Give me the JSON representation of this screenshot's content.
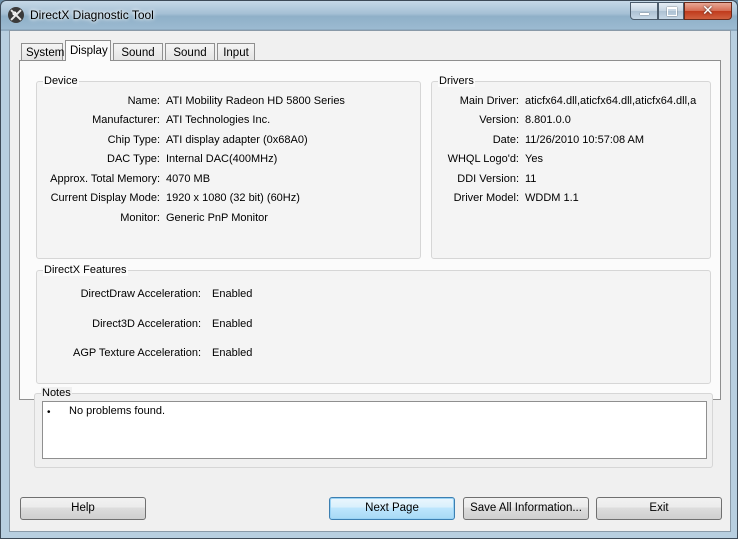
{
  "window": {
    "title": "DirectX Diagnostic Tool",
    "controls": {
      "minimize": "–",
      "maximize": "□",
      "close": "✕"
    }
  },
  "tabs": [
    {
      "label": "System"
    },
    {
      "label": "Display"
    },
    {
      "label": "Sound 1"
    },
    {
      "label": "Sound 2"
    },
    {
      "label": "Input"
    }
  ],
  "active_tab": "Display",
  "device": {
    "title": "Device",
    "rows": [
      {
        "label": "Name:",
        "value": "ATI Mobility Radeon HD 5800 Series"
      },
      {
        "label": "Manufacturer:",
        "value": "ATI Technologies Inc."
      },
      {
        "label": "Chip Type:",
        "value": "ATI display adapter (0x68A0)"
      },
      {
        "label": "DAC Type:",
        "value": "Internal DAC(400MHz)"
      },
      {
        "label": "Approx. Total Memory:",
        "value": "4070 MB"
      },
      {
        "label": "Current Display Mode:",
        "value": "1920 x 1080 (32 bit) (60Hz)"
      },
      {
        "label": "Monitor:",
        "value": "Generic PnP Monitor"
      }
    ]
  },
  "drivers": {
    "title": "Drivers",
    "rows": [
      {
        "label": "Main Driver:",
        "value": "aticfx64.dll,aticfx64.dll,aticfx64.dll,a"
      },
      {
        "label": "Version:",
        "value": "8.801.0.0"
      },
      {
        "label": "Date:",
        "value": "11/26/2010 10:57:08 AM"
      },
      {
        "label": "WHQL Logo'd:",
        "value": "Yes"
      },
      {
        "label": "DDI Version:",
        "value": "11"
      },
      {
        "label": "Driver Model:",
        "value": "WDDM 1.1"
      }
    ]
  },
  "features": {
    "title": "DirectX Features",
    "rows": [
      {
        "label": "DirectDraw Acceleration:",
        "value": "Enabled"
      },
      {
        "label": "Direct3D Acceleration:",
        "value": "Enabled"
      },
      {
        "label": "AGP Texture Acceleration:",
        "value": "Enabled"
      }
    ]
  },
  "notes": {
    "title": "Notes",
    "bullet": "•",
    "items": [
      "No problems found."
    ]
  },
  "buttons": {
    "help": "Help",
    "next_page": "Next Page",
    "save_all": "Save All Information...",
    "exit": "Exit"
  }
}
